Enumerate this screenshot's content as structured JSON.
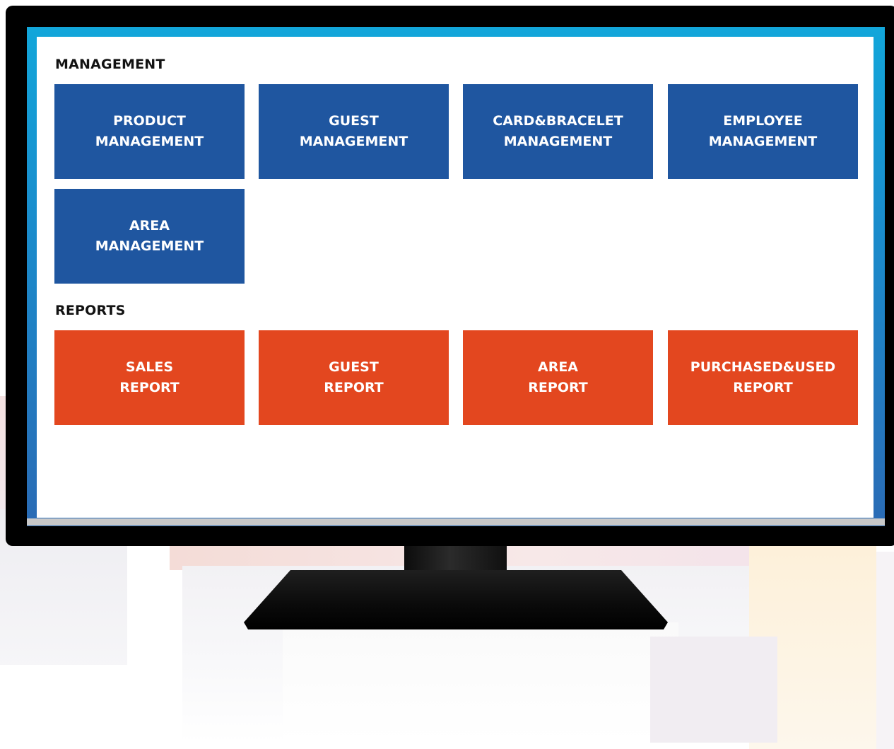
{
  "colors": {
    "management_tile": "#1f56a0",
    "report_tile": "#e3471f",
    "screen_border": "#1a8ccc",
    "monitor": "#000000"
  },
  "management": {
    "heading": "MANAGEMENT",
    "tiles": [
      {
        "label": "PRODUCT\nMANAGEMENT"
      },
      {
        "label": "GUEST\nMANAGEMENT"
      },
      {
        "label": "CARD&BRACELET\nMANAGEMENT"
      },
      {
        "label": "EMPLOYEE\nMANAGEMENT"
      },
      {
        "label": "AREA\nMANAGEMENT"
      }
    ]
  },
  "reports": {
    "heading": "REPORTS",
    "tiles": [
      {
        "label": "SALES\nREPORT"
      },
      {
        "label": "GUEST\nREPORT"
      },
      {
        "label": "AREA\nREPORT"
      },
      {
        "label": "PURCHASED&USED\nREPORT"
      }
    ]
  }
}
